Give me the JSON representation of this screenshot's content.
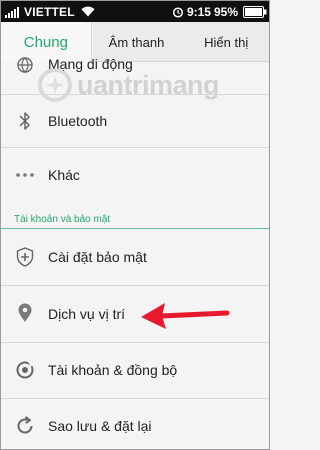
{
  "status": {
    "carrier": "VIETTEL",
    "time": "9:15",
    "battery": "95%"
  },
  "tabs": [
    {
      "label": "Chung",
      "active": true
    },
    {
      "label": "Âm thanh",
      "active": false
    },
    {
      "label": "Hiển thị",
      "active": false
    }
  ],
  "watermark": {
    "text": "uantrimang"
  },
  "rows": [
    {
      "label": "Mạng di động",
      "icon": "globe-icon"
    },
    {
      "label": "Bluetooth",
      "icon": "bluetooth-icon"
    },
    {
      "label": "Khác",
      "icon": "more-dots-icon"
    }
  ],
  "section": {
    "title": "Tài khoản và bảo mật"
  },
  "security_rows": [
    {
      "label": "Cài đặt bảo mật",
      "icon": "shield-icon"
    },
    {
      "label": "Dịch vụ vị trí",
      "icon": "location-pin-icon"
    },
    {
      "label": "Tài khoản & đồng bộ",
      "icon": "sync-icon"
    },
    {
      "label": "Sao lưu & đặt lại",
      "icon": "backup-restore-icon"
    }
  ],
  "colors": {
    "accent": "#23a86f",
    "annotation_arrow": "#e8192c"
  }
}
